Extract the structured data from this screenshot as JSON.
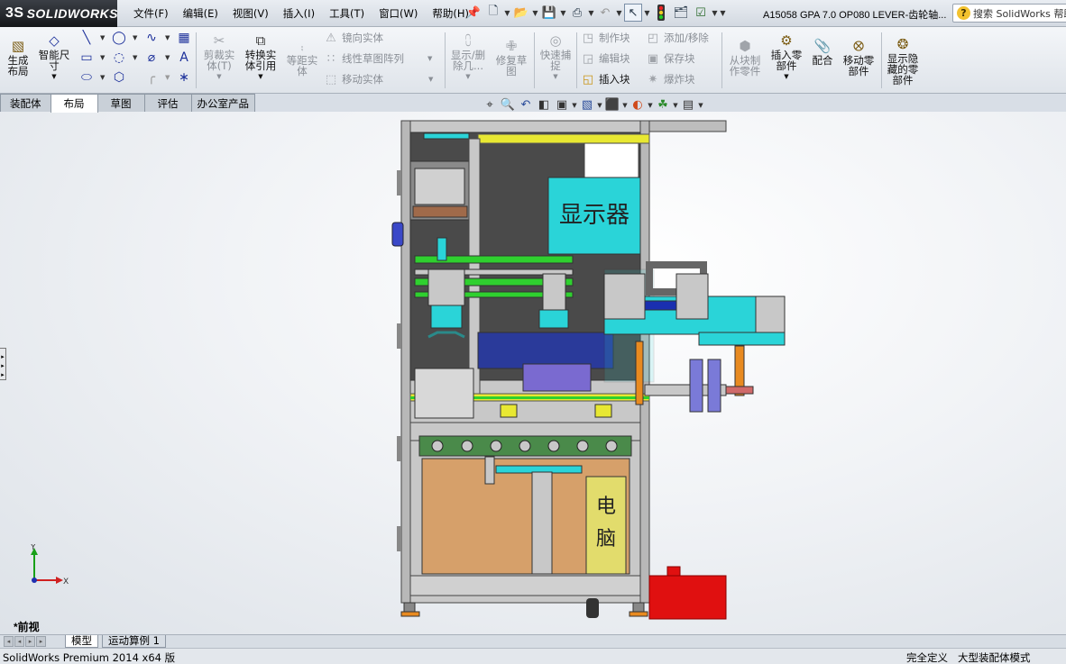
{
  "app": {
    "brand_mark": "3S",
    "brand_name": "SOLIDWORKS"
  },
  "menu": [
    "文件(F)",
    "编辑(E)",
    "视图(V)",
    "插入(I)",
    "工具(T)",
    "窗口(W)",
    "帮助(H)"
  ],
  "quick_access_icons": [
    "pin-icon",
    "new-document-icon",
    "open-icon",
    "save-icon",
    "print-icon",
    "undo-icon",
    "select-icon",
    "rebuild-icon",
    "file-properties-icon",
    "options-icon"
  ],
  "document_title": "A15058 GPA 7.0 OP080 LEVER-齿轮轴...",
  "search": {
    "text": "搜索 SolidWorks 帮助"
  },
  "ribbon": {
    "generate_layout": "生成\n布局",
    "smart_dimension": "智能尺\n寸",
    "trim_entities": "剪裁实\n体(T)",
    "convert_entities": "转换实\n体引用",
    "offset_entities": "等距实\n体",
    "mirror_entities": "镜向实体",
    "linear_pattern": "线性草图阵列",
    "move_entities": "移动实体",
    "display_delete": "显示/删\n除几...",
    "repair_sketch": "修复草\n图",
    "quick_snaps": "快速捕\n捉",
    "make_block": "制作块",
    "edit_block": "编辑块",
    "insert_block": "插入块",
    "add_remove": "添加/移除",
    "save_block": "保存块",
    "explode_block": "爆炸块",
    "make_part_from_block": "从块制\n作零件",
    "insert_part": "插入零\n部件",
    "mate": "配合",
    "move_component": "移动零\n部件",
    "show_hidden": "显示隐\n藏的零\n部件"
  },
  "command_tabs": [
    {
      "label": "装配体",
      "active": false
    },
    {
      "label": "布局",
      "active": true
    },
    {
      "label": "草图",
      "active": false
    },
    {
      "label": "评估",
      "active": false
    },
    {
      "label": "办公室产品",
      "active": false
    }
  ],
  "heads_up_toolbar_icons": [
    "zoom-to-fit-icon",
    "zoom-area-icon",
    "previous-view-icon",
    "section-view-icon",
    "view-orientation-icon",
    "display-style-icon",
    "hide-show-icon",
    "edit-appearance-icon",
    "apply-scene-icon",
    "view-settings-icon"
  ],
  "model_labels": {
    "display": "显示器",
    "computer_1": "电",
    "computer_2": "脑"
  },
  "triad": {
    "y": "Y",
    "x": "X"
  },
  "view_name": "*前视",
  "bottom_tabs": [
    {
      "label": "模型",
      "active": true
    },
    {
      "label": "运动算例 1",
      "active": false
    }
  ],
  "status": {
    "left": "SolidWorks Premium 2014 x64 版",
    "definition": "完全定义",
    "mode": "大型装配体模式"
  },
  "colors": {
    "ribbon_icon": "#7a5a10",
    "display_panel": "#2ad4d8",
    "computer_panel": "#e2dc6c",
    "cabinet_wood": "#d6a06a",
    "frame_gray": "#c6c6c6",
    "green_rail": "#2fd02f",
    "red_box": "#e01010",
    "yellow_rail": "#e8e832"
  }
}
